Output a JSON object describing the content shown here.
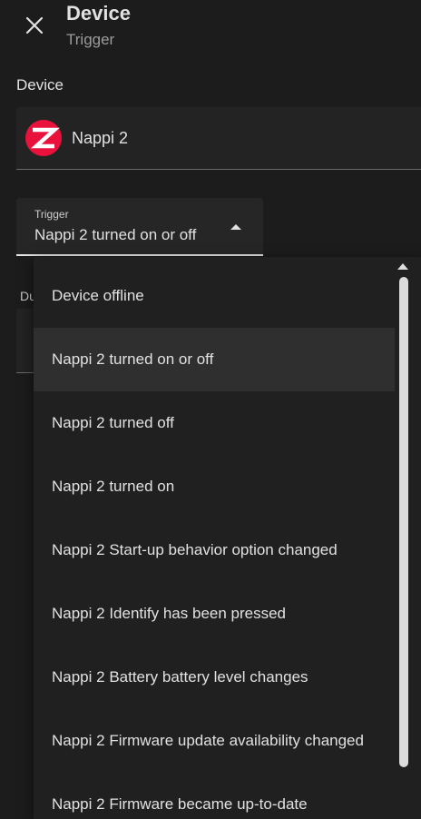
{
  "header": {
    "title": "Device",
    "subtitle": "Trigger"
  },
  "device_section": {
    "label": "Device",
    "selected_device": "Nappi 2",
    "logo_icon": "zigbee-icon",
    "logo_color": "#e8123c"
  },
  "trigger": {
    "label": "Trigger",
    "value": "Nappi 2 turned on or off"
  },
  "behind_field": {
    "label": "Du"
  },
  "menu": {
    "items": [
      "Device offline",
      "Nappi 2 turned on or off",
      "Nappi 2 turned off",
      "Nappi 2 turned on",
      "Nappi 2 Start-up behavior option changed",
      "Nappi 2 Identify has been pressed",
      "Nappi 2 Battery battery level changes",
      "Nappi 2 Firmware update availability changed",
      "Nappi 2 Firmware became up-to-date"
    ],
    "selected": "Nappi 2 turned on or off"
  }
}
